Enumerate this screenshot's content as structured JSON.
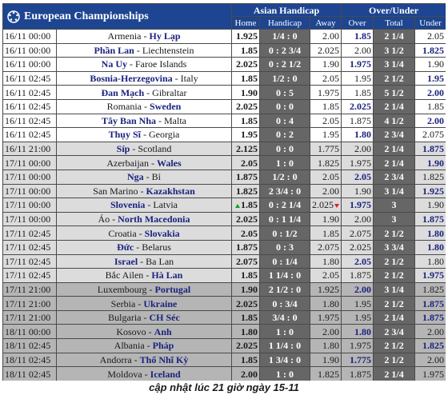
{
  "header": {
    "competition": "European Championships",
    "asian_handicap": "Asian Handicap",
    "over_under": "Over/Under",
    "home": "Home",
    "handicap": "Handicap",
    "away": "Away",
    "over": "Over",
    "total": "Total",
    "under": "Under"
  },
  "rows": [
    {
      "time": "16/11 00:00",
      "t1": "Armenia",
      "t2": "Hy Lạp",
      "fav": 2,
      "home": "1.925",
      "hdc": "1/4 : 0",
      "away": "2.00",
      "over": "1.85",
      "over_hl": true,
      "total": "2 1/4",
      "under": "2.05",
      "under_hl": false,
      "group": 1
    },
    {
      "time": "16/11 00:00",
      "t1": "Phần Lan",
      "t2": "Liechtenstein",
      "fav": 1,
      "home": "1.85",
      "hdc": "0 : 2 3/4",
      "away": "2.025",
      "over": "2.00",
      "over_hl": false,
      "total": "3 1/2",
      "under": "1.825",
      "under_hl": true,
      "group": 1
    },
    {
      "time": "16/11 00:00",
      "t1": "Na Uy",
      "t2": "Faroe Islands",
      "fav": 1,
      "home": "2.025",
      "hdc": "0 : 2 1/2",
      "away": "1.90",
      "over": "1.975",
      "over_hl": true,
      "total": "3 1/4",
      "under": "1.90",
      "under_hl": false,
      "group": 1
    },
    {
      "time": "16/11 02:45",
      "t1": "Bosnia-Herzegovina",
      "t2": "Italy",
      "fav": 1,
      "home": "1.85",
      "hdc": "1/2 : 0",
      "away": "2.05",
      "over": "1.95",
      "over_hl": false,
      "total": "2 1/2",
      "under": "1.95",
      "under_hl": true,
      "group": 1
    },
    {
      "time": "16/11 02:45",
      "t1": "Đan Mạch",
      "t2": "Gibraltar",
      "fav": 1,
      "home": "1.90",
      "hdc": "0 : 5",
      "away": "1.975",
      "over": "1.85",
      "over_hl": false,
      "total": "5 1/2",
      "under": "2.00",
      "under_hl": true,
      "group": 1
    },
    {
      "time": "16/11 02:45",
      "t1": "Romania",
      "t2": "Sweden",
      "fav": 2,
      "home": "2.025",
      "hdc": "0 : 0",
      "away": "1.85",
      "over": "2.025",
      "over_hl": true,
      "total": "2 1/4",
      "under": "1.85",
      "under_hl": false,
      "group": 1
    },
    {
      "time": "16/11 02:45",
      "t1": "Tây Ban Nha",
      "t2": "Malta",
      "fav": 1,
      "home": "1.85",
      "hdc": "0 : 4",
      "away": "2.05",
      "over": "1.875",
      "over_hl": false,
      "total": "4 1/2",
      "under": "2.00",
      "under_hl": true,
      "group": 1
    },
    {
      "time": "16/11 02:45",
      "t1": "Thụy Sĩ",
      "t2": "Georgia",
      "fav": 1,
      "home": "1.95",
      "hdc": "0 : 2",
      "away": "1.95",
      "over": "1.80",
      "over_hl": true,
      "total": "2 3/4",
      "under": "2.075",
      "under_hl": false,
      "group": 1
    },
    {
      "time": "16/11 21:00",
      "t1": "Síp",
      "t2": "Scotland",
      "fav": 1,
      "home": "2.125",
      "hdc": "0 : 0",
      "away": "1.775",
      "over": "2.00",
      "over_hl": false,
      "total": "2 1/4",
      "under": "1.875",
      "under_hl": true,
      "group": 2
    },
    {
      "time": "17/11 00:00",
      "t1": "Azerbaijan",
      "t2": "Wales",
      "fav": 2,
      "home": "2.05",
      "hdc": "1 : 0",
      "away": "1.825",
      "over": "1.975",
      "over_hl": false,
      "total": "2 1/4",
      "under": "1.90",
      "under_hl": true,
      "group": 2
    },
    {
      "time": "17/11 00:00",
      "t1": "Nga",
      "t2": "Bỉ",
      "fav": 1,
      "home": "1.875",
      "hdc": "1/2 : 0",
      "away": "2.05",
      "over": "2.05",
      "over_hl": true,
      "total": "2 3/4",
      "under": "1.825",
      "under_hl": false,
      "group": 2
    },
    {
      "time": "17/11 00:00",
      "t1": "San Marino",
      "t2": "Kazakhstan",
      "fav": 2,
      "home": "1.825",
      "hdc": "2 3/4 : 0",
      "away": "2.00",
      "over": "1.90",
      "over_hl": false,
      "total": "3 1/4",
      "under": "1.925",
      "under_hl": true,
      "group": 2
    },
    {
      "time": "17/11 00:00",
      "t1": "Slovenia",
      "t2": "Latvia",
      "fav": 1,
      "home": "1.85",
      "hdc": "0 : 2 1/4",
      "away": "2.025",
      "over": "1.975",
      "over_hl": true,
      "total": "3",
      "under": "1.90",
      "under_hl": false,
      "group": 2,
      "home_arrow": "up",
      "away_arrow": "down"
    },
    {
      "time": "17/11 00:00",
      "t1": "Áo",
      "t2": "North Macedonia",
      "fav": 2,
      "home": "2.025",
      "hdc": "0 : 1 1/4",
      "away": "1.90",
      "over": "2.00",
      "over_hl": false,
      "total": "3",
      "under": "1.875",
      "under_hl": true,
      "group": 2
    },
    {
      "time": "17/11 02:45",
      "t1": "Croatia",
      "t2": "Slovakia",
      "fav": 2,
      "home": "2.05",
      "hdc": "0 : 1/2",
      "away": "1.85",
      "over": "2.075",
      "over_hl": false,
      "total": "2 1/2",
      "under": "1.80",
      "under_hl": true,
      "group": 2
    },
    {
      "time": "17/11 02:45",
      "t1": "Đức",
      "t2": "Belarus",
      "fav": 1,
      "home": "1.875",
      "hdc": "0 : 3",
      "away": "2.075",
      "over": "2.025",
      "over_hl": false,
      "total": "3 3/4",
      "under": "1.80",
      "under_hl": true,
      "group": 2
    },
    {
      "time": "17/11 02:45",
      "t1": "Israel",
      "t2": "Ba Lan",
      "fav": 1,
      "home": "2.075",
      "hdc": "0 : 1/4",
      "away": "1.80",
      "over": "2.05",
      "over_hl": true,
      "total": "2 1/2",
      "under": "1.80",
      "under_hl": false,
      "group": 2
    },
    {
      "time": "17/11 02:45",
      "t1": "Bắc Ailen",
      "t2": "Hà Lan",
      "fav": 2,
      "home": "1.85",
      "hdc": "1 1/4 : 0",
      "away": "2.05",
      "over": "1.875",
      "over_hl": false,
      "total": "2 1/2",
      "under": "1.975",
      "under_hl": true,
      "group": 2
    },
    {
      "time": "17/11 21:00",
      "t1": "Luxembourg",
      "t2": "Portugal",
      "fav": 2,
      "home": "1.90",
      "hdc": "2 1/2 : 0",
      "away": "1.925",
      "over": "2.00",
      "over_hl": true,
      "total": "3 1/4",
      "under": "1.825",
      "under_hl": false,
      "group": 3
    },
    {
      "time": "17/11 21:00",
      "t1": "Serbia",
      "t2": "Ukraine",
      "fav": 2,
      "home": "2.025",
      "hdc": "0 : 3/4",
      "away": "1.80",
      "over": "1.95",
      "over_hl": false,
      "total": "2 1/2",
      "under": "1.875",
      "under_hl": true,
      "group": 3
    },
    {
      "time": "17/11 21:00",
      "t1": "Bulgaria",
      "t2": "CH Séc",
      "fav": 2,
      "home": "1.85",
      "hdc": "3/4 : 0",
      "away": "1.975",
      "over": "1.95",
      "over_hl": false,
      "total": "2 1/4",
      "under": "1.875",
      "under_hl": true,
      "group": 3
    },
    {
      "time": "18/11 00:00",
      "t1": "Kosovo",
      "t2": "Anh",
      "fav": 2,
      "home": "1.80",
      "hdc": "1 : 0",
      "away": "2.00",
      "over": "1.80",
      "over_hl": true,
      "total": "2 3/4",
      "under": "2.00",
      "under_hl": false,
      "group": 3
    },
    {
      "time": "18/11 02:45",
      "t1": "Albania",
      "t2": "Pháp",
      "fav": 2,
      "home": "2.025",
      "hdc": "1 1/4 : 0",
      "away": "1.80",
      "over": "1.975",
      "over_hl": false,
      "total": "2 1/2",
      "under": "1.825",
      "under_hl": true,
      "group": 3
    },
    {
      "time": "18/11 02:45",
      "t1": "Andorra",
      "t2": "Thổ Nhĩ Kỳ",
      "fav": 2,
      "home": "1.85",
      "hdc": "1 3/4 : 0",
      "away": "1.90",
      "over": "1.775",
      "over_hl": true,
      "total": "2 1/2",
      "under": "2.00",
      "under_hl": false,
      "group": 3
    },
    {
      "time": "18/11 02:45",
      "t1": "Moldova",
      "t2": "Iceland",
      "fav": 2,
      "home": "2.00",
      "hdc": "1 : 0",
      "away": "1.825",
      "over": "1.875",
      "over_hl": false,
      "total": "2 1/4",
      "under": "1.975",
      "under_hl": false,
      "group": 3
    }
  ],
  "footer": "cập nhật lúc 21 giờ ngày 15-11"
}
